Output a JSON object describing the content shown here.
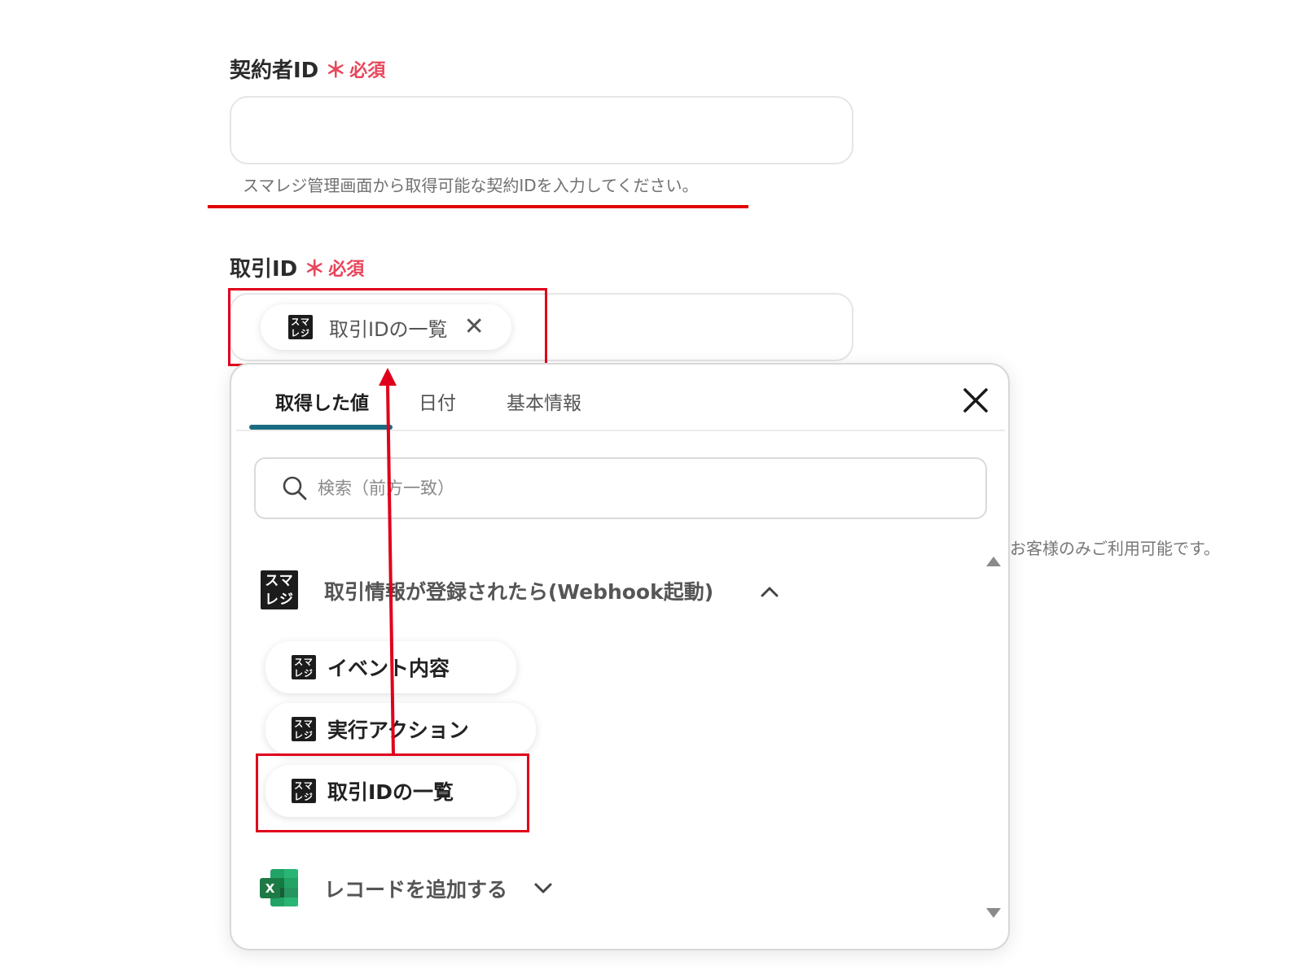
{
  "contractor_field": {
    "label": "契約者ID",
    "required_star": "＊",
    "required_text": "必須",
    "value": "",
    "hint": "スマレジ管理画面から取得可能な契約IDを入力してください。"
  },
  "transaction_field": {
    "label": "取引ID",
    "required_star": "＊",
    "required_text": "必須",
    "chip_label": "取引IDの一覧"
  },
  "side_note": "お客様のみご利用可能です。",
  "popup": {
    "tabs": [
      {
        "label": "取得した値",
        "active": true
      },
      {
        "label": "日付",
        "active": false
      },
      {
        "label": "基本情報",
        "active": false
      }
    ],
    "search_placeholder": "検索（前方一致）",
    "groups": [
      {
        "title": "取引情報が登録されたら(Webhook起動)",
        "expanded": true,
        "items": [
          "イベント内容",
          "実行アクション",
          "取引IDの一覧"
        ]
      },
      {
        "title": "レコードを追加する",
        "expanded": false,
        "items": []
      }
    ]
  },
  "icons": {
    "sumareji_top": "スマ",
    "sumareji_bottom": "レジ",
    "excel_letter": "X"
  },
  "colors": {
    "required": "#e8455a",
    "annotation_red": "#e0001b",
    "tab_accent": "#1b6c80",
    "excel_green": "#1d7a45"
  }
}
